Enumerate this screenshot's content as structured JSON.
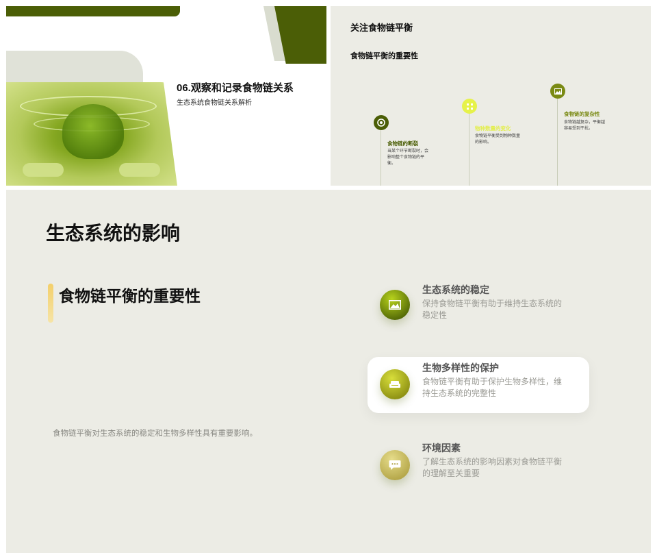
{
  "slide1": {
    "title": "06.观察和记录食物链关系",
    "subtitle": "生态系统食物链关系解析"
  },
  "slide2": {
    "heading": "关注食物链平衡",
    "subheading": "食物链平衡的重要性",
    "timeline": [
      {
        "title": "食物链的断裂",
        "desc": "当某个环节断裂时，会影响整个食物链的平衡。",
        "icon": "target-icon",
        "color": "#4b5e06"
      },
      {
        "title": "物种数量的变化",
        "desc": "食物链平衡受到物种数量的影响。",
        "icon": "grid-icon",
        "color": "#e6f24a"
      },
      {
        "title": "食物链的复杂性",
        "desc": "食物链越复杂，平衡越容易受到干扰。",
        "icon": "image-icon",
        "color": "#7a8a14"
      }
    ]
  },
  "slide3": {
    "title": "生态系统的影响",
    "section_title": "食物链平衡的重要性",
    "summary": "食物链平衡对生态系统的稳定和生物多样性具有重要影响。",
    "features": [
      {
        "title": "生态系统的稳定",
        "desc": "保持食物链平衡有助于维持生态系统的稳定性",
        "icon": "image-icon"
      },
      {
        "title": "生物多样性的保护",
        "desc": "食物链平衡有助于保护生物多样性，维持生态系统的完整性",
        "icon": "sofa-icon"
      },
      {
        "title": "环境因素",
        "desc": "了解生态系统的影响因素对食物链平衡的理解至关重要",
        "icon": "chat-icon"
      }
    ]
  },
  "colors": {
    "brand_green": "#4b5e06",
    "lime": "#e6f24a",
    "panel": "#ecece5",
    "accent_yellow": "#f3cf6a"
  }
}
